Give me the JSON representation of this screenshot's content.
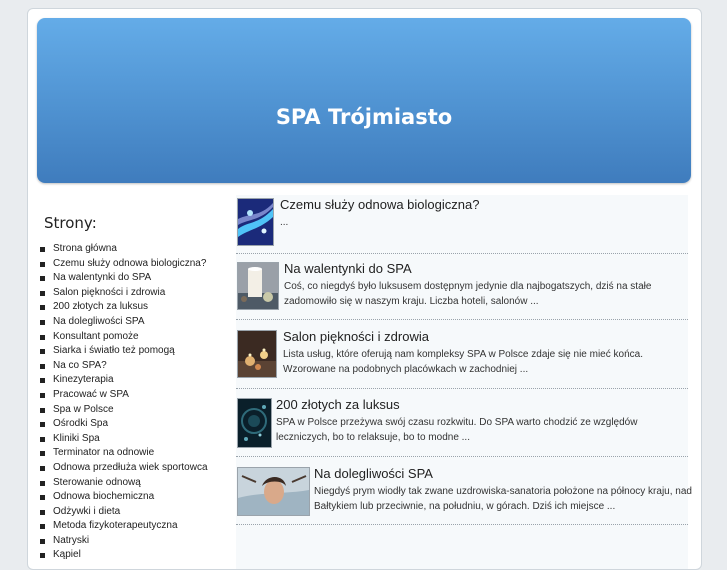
{
  "site": {
    "title": "SPA Trójmiasto"
  },
  "sidebar": {
    "heading": "Strony:",
    "items": [
      "Strona główna",
      "Czemu służy odnowa biologiczna?",
      "Na walentynki do SPA",
      "Salon piękności i zdrowia",
      "200 złotych za luksus",
      "Na dolegliwości SPA",
      "Konsultant pomoże",
      "Siarka i światło też pomogą",
      "Na co SPA?",
      "Kinezyterapia",
      "Pracować w SPA",
      "Spa w Polsce",
      "Ośrodki Spa",
      "Kliniki Spa",
      "Terminator na odnowie",
      "Odnowa przedłuża wiek sportowca",
      "Sterowanie odnową",
      "Odnowa biochemiczna",
      "Odżywki i dieta",
      "Metoda fizykoterapeutyczna",
      "Natryski",
      "Kąpiel"
    ]
  },
  "posts": [
    {
      "title": "Czemu służy odnowa biologiczna?",
      "excerpt": "...",
      "thumb_icon": "blue-lights-thumbnail"
    },
    {
      "title": "Na walentynki do SPA",
      "excerpt": "Coś, co niegdyś było luksusem dostępnym jedynie dla najbogatszych, dziś na stałe zadomowiło się w naszym kraju. Liczba hoteli, salonów ...",
      "thumb_icon": "candle-thumbnail"
    },
    {
      "title": "Salon piękności i zdrowia",
      "excerpt": "Lista usług, które oferują nam kompleksy SPA w Polsce zdaje się nie mieć końca. Wzorowane na podobnych placówkach w zachodniej ...",
      "thumb_icon": "candles-thumbnail"
    },
    {
      "title": "200 złotych za luksus",
      "excerpt": "SPA w Polsce przeżywa swój czasu rozkwitu. Do SPA warto chodzić ze względów leczniczych, bo to relaksuje, bo to modne ...",
      "thumb_icon": "water-drops-thumbnail"
    },
    {
      "title": "Na dolegliwości SPA",
      "excerpt": "Niegdyś prym wiodły tak zwane uzdrowiska-sanatoria położone na północy kraju, nad Bałtykiem lub przeciwnie, na południu, w górach. Dziś ich miejsce ...",
      "thumb_icon": "woman-in-bath-thumbnail"
    }
  ]
}
